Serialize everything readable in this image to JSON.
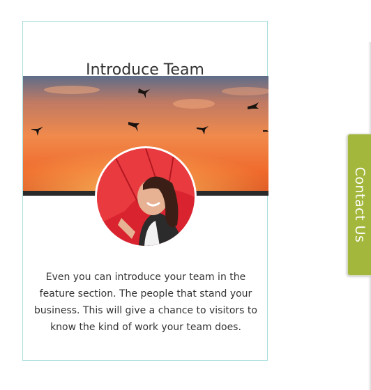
{
  "card": {
    "title": "Introduce Team",
    "banner_image": "sunset-birds-banner",
    "avatar_image": "woman-red-umbrella-portrait",
    "description": "Even you can introduce your team in the feature section. The people that stand your business. This will give a chance to visitors to know the kind of work your team does."
  },
  "contact_tab": {
    "label": "Contact Us",
    "color": "#a3b73c"
  },
  "colors": {
    "card_border": "#a9dede",
    "text": "#333333"
  }
}
